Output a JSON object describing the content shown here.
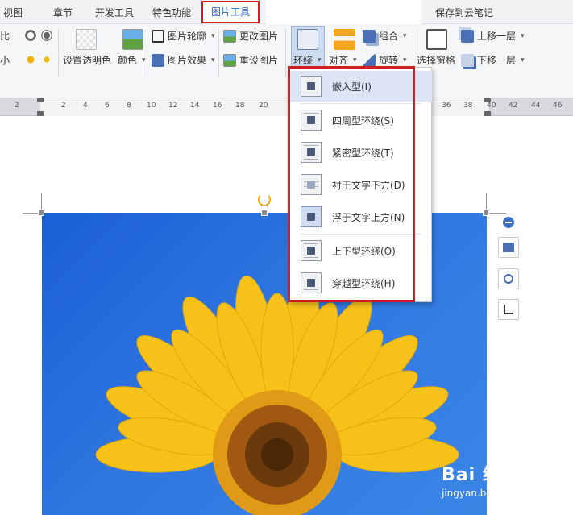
{
  "tabs": [
    {
      "label": "视图",
      "active": false
    },
    {
      "label": "章节",
      "active": false
    },
    {
      "label": "开发工具",
      "active": false
    },
    {
      "label": "特色功能",
      "active": false
    },
    {
      "label": "图片工具",
      "active": true
    },
    {
      "label": "保存到云笔记",
      "active": false
    }
  ],
  "ribbon": {
    "left_partial_top": "比",
    "left_partial_bottom": "小",
    "transparency": "设置透明色",
    "color": "颜色",
    "outline": "图片轮廓",
    "effect": "图片效果",
    "change_picture": "更改图片",
    "reset_picture": "重设图片",
    "wrap": "环绕",
    "align": "对齐",
    "group": "组合",
    "rotate": "旋转",
    "selection_pane": "选择窗格",
    "bring_forward": "上移一层",
    "send_backward": "下移一层"
  },
  "ruler_ticks": [
    "2",
    "2",
    "4",
    "6",
    "8",
    "10",
    "12",
    "14",
    "16",
    "18",
    "20",
    "36",
    "38",
    "40",
    "42",
    "44",
    "46"
  ],
  "wrap_menu": {
    "items": [
      {
        "label": "嵌入型(I)",
        "highlighted": true
      },
      {
        "label": "四周型环绕(S)",
        "highlighted": false
      },
      {
        "label": "紧密型环绕(T)",
        "highlighted": false
      },
      {
        "label": "衬于文字下方(D)",
        "highlighted": false
      },
      {
        "label": "浮于文字上方(N)",
        "highlighted": false,
        "selected": true
      },
      {
        "label": "上下型环绕(O)",
        "highlighted": false
      },
      {
        "label": "穿越型环绕(H)",
        "highlighted": false
      }
    ]
  },
  "watermark": {
    "big": "Bai 经验",
    "small": "jingyan.baidu.com"
  },
  "colors": {
    "accent_red": "#d11f1f",
    "active_tab_text": "#2a63c3",
    "highlight": "#dbe5f4"
  }
}
